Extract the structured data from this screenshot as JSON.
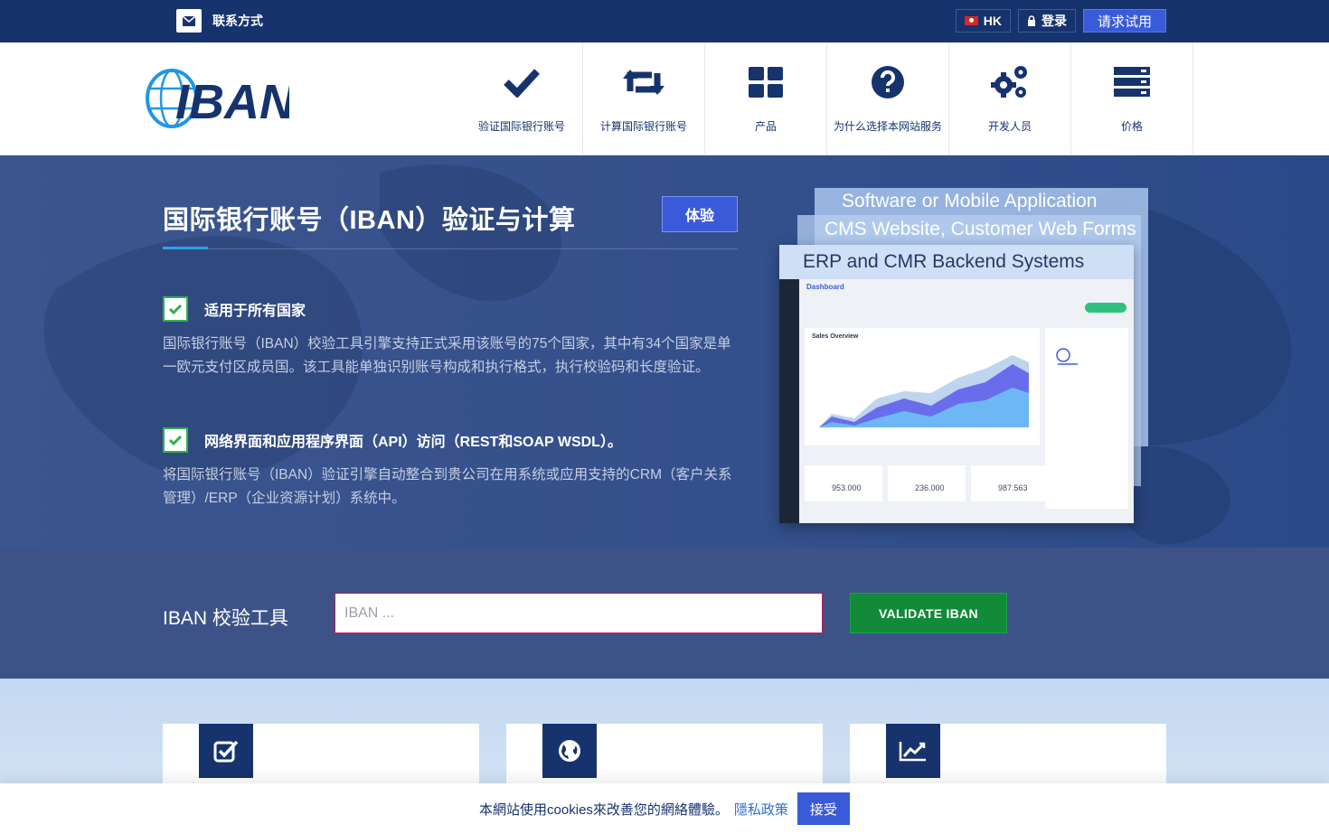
{
  "topbar": {
    "contact_label": "联系方式",
    "region_label": "HK",
    "login_label": "登录",
    "trial_label": "请求试用"
  },
  "header": {
    "logo_text": "IBAN",
    "nav": [
      {
        "label": "验证国际银行账号",
        "icon": "checkmark-icon"
      },
      {
        "label": "计算国际银行账号",
        "icon": "retweet-icon"
      },
      {
        "label": "产品",
        "icon": "grid-icon"
      },
      {
        "label": "为什么选择本网站服务",
        "icon": "question-icon"
      },
      {
        "label": "开发人员",
        "icon": "gears-icon"
      },
      {
        "label": "价格",
        "icon": "server-icon"
      }
    ]
  },
  "hero": {
    "title": "国际银行账号（IBAN）验证与计算",
    "try_label": "体验",
    "features": [
      {
        "title": "适用于所有国家",
        "body": "国际银行账号（IBAN）校验工具引擎支持正式采用该账号的75个国家，其中有34个国家是单一欧元支付区成员国。该工具能单独识别账号构成和执行格式，执行校验码和长度验证。"
      },
      {
        "title": "网络界面和应用程序界面（API）访问（REST和SOAP WSDL）。",
        "body": "将国际银行账号（IBAN）验证引擎自动整合到贵公司在用系统或应用支持的CRM（客户关系管理）/ERP（企业资源计划）系统中。"
      }
    ],
    "mockup": {
      "label1": "Software or Mobile Application",
      "label2": "CMS Website, Customer Web Forms",
      "label3": "ERP and CMR Backend Systems",
      "dashboard_title": "Dashboard",
      "chart_title": "Sales Overview",
      "stats": [
        "953.000",
        "236.000",
        "987.563"
      ]
    }
  },
  "validator": {
    "label": "IBAN 校验工具",
    "placeholder": "IBAN ...",
    "button_label": "VALIDATE IBAN"
  },
  "feature_cards": [
    {
      "icon": "check-square-icon"
    },
    {
      "icon": "globe-icon"
    },
    {
      "icon": "line-chart-icon"
    }
  ],
  "cookie": {
    "text": "本網站使用cookies來改善您的網絡體驗。",
    "policy_link": "隱私政策",
    "accept_label": "接受"
  },
  "colors": {
    "brand_navy": "#16336e",
    "accent_blue": "#3a5bd9",
    "validate_green": "#128a3a",
    "check_green": "#2fb24a"
  }
}
